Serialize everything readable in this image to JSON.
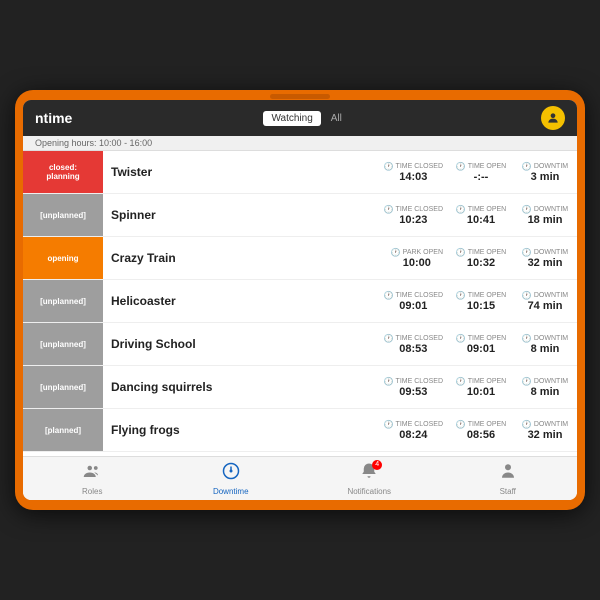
{
  "header": {
    "title": "ntime",
    "tab_watching": "Watching",
    "tab_all": "All",
    "icon": "🔍"
  },
  "subheader": {
    "opening_hours": "Opening hours: 10:00 - 16:00"
  },
  "rides": [
    {
      "id": 1,
      "status_label": "closed:\nplanning",
      "status_class": "status-closed",
      "name": "Twister",
      "time_closed_label": "TIME CLOSED",
      "time_closed": "14:03",
      "time_open_label": "TIME OPEN",
      "time_open": "-:--",
      "downtime_label": "DOWNTIM",
      "downtime": "3 min"
    },
    {
      "id": 2,
      "status_label": "[unplanned]",
      "status_class": "status-unplanned",
      "name": "Spinner",
      "time_closed_label": "TIME CLOSED",
      "time_closed": "10:23",
      "time_open_label": "TIME OPEN",
      "time_open": "10:41",
      "downtime_label": "DOWNTIM",
      "downtime": "18 min"
    },
    {
      "id": 3,
      "status_label": "opening",
      "status_class": "status-opening",
      "name": "Crazy Train",
      "time_closed_label": "PARK OPEN",
      "time_closed": "10:00",
      "time_open_label": "TIME OPEN",
      "time_open": "10:32",
      "downtime_label": "DOWNTIM",
      "downtime": "32 min"
    },
    {
      "id": 4,
      "status_label": "[unplanned]",
      "status_class": "status-unplanned",
      "name": "Helicoaster",
      "time_closed_label": "TIME CLOSED",
      "time_closed": "09:01",
      "time_open_label": "TIME OPEN",
      "time_open": "10:15",
      "downtime_label": "DOWNTIM",
      "downtime": "74 min"
    },
    {
      "id": 5,
      "status_label": "[unplanned]",
      "status_class": "status-unplanned",
      "name": "Driving School",
      "time_closed_label": "TIME CLOSED",
      "time_closed": "08:53",
      "time_open_label": "TIME OPEN",
      "time_open": "09:01",
      "downtime_label": "DOWNTIM",
      "downtime": "8 min"
    },
    {
      "id": 6,
      "status_label": "[unplanned]",
      "status_class": "status-unplanned",
      "name": "Dancing squirrels",
      "time_closed_label": "TIME CLOSED",
      "time_closed": "09:53",
      "time_open_label": "TIME OPEN",
      "time_open": "10:01",
      "downtime_label": "DOWNTIM",
      "downtime": "8 min"
    },
    {
      "id": 7,
      "status_label": "[planned]",
      "status_class": "status-unplanned",
      "name": "Flying frogs",
      "time_closed_label": "TIME CLOSED",
      "time_closed": "08:24",
      "time_open_label": "TIME OPEN",
      "time_open": "08:56",
      "downtime_label": "DOWNTIM",
      "downtime": "32 min"
    }
  ],
  "nav": {
    "roles_label": "Roles",
    "downtime_label": "Downtime",
    "notifications_label": "Notifications",
    "staff_label": "Staff",
    "notification_badge": "4"
  }
}
